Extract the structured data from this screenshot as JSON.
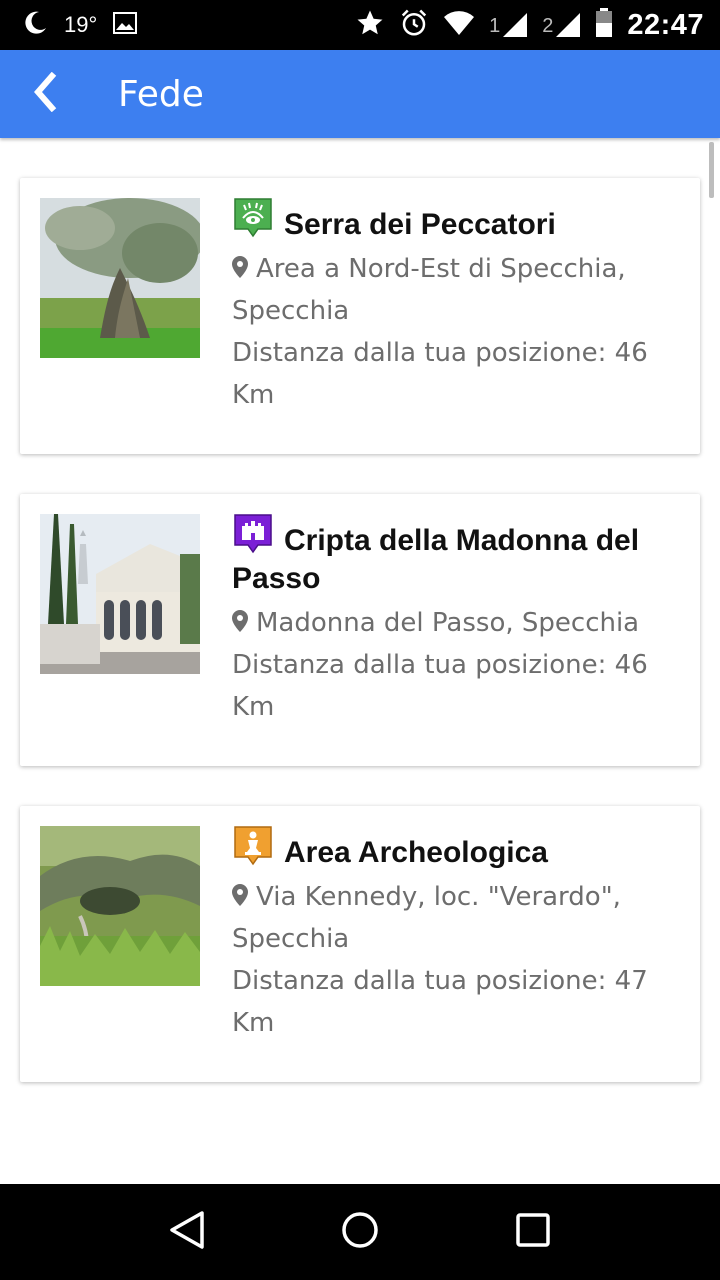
{
  "status_bar": {
    "temperature": "19°",
    "sim1": "1",
    "sim2": "2",
    "time": "22:47"
  },
  "app_bar": {
    "title": "Fede",
    "back_icon": "chevron-left-icon"
  },
  "items": [
    {
      "title": "Serra dei Peccatori",
      "address": "Area a Nord-Est di Specchia, Specchia",
      "distance": "Distanza dalla tua posizione: 46 Km",
      "category_icon": "nature-eye-icon",
      "category_color": "#4caf50"
    },
    {
      "title": "Cripta della Madonna del Passo",
      "address": "Madonna del Passo, Specchia",
      "distance": "Distanza dalla tua posizione: 46 Km",
      "category_icon": "castle-icon",
      "category_color": "#7b1fd6"
    },
    {
      "title": "Area Archeologica",
      "address": "Via Kennedy, loc. \"Verardo\", Specchia",
      "distance": "Distanza dalla tua posizione: 47 Km",
      "category_icon": "statue-icon",
      "category_color": "#f0a030"
    }
  ],
  "nav_bar": {
    "back": "triangle-back-icon",
    "home": "circle-home-icon",
    "recents": "square-recents-icon"
  },
  "colors": {
    "app_bar": "#3d7ff0",
    "secondary_text": "#6d6d6d"
  }
}
